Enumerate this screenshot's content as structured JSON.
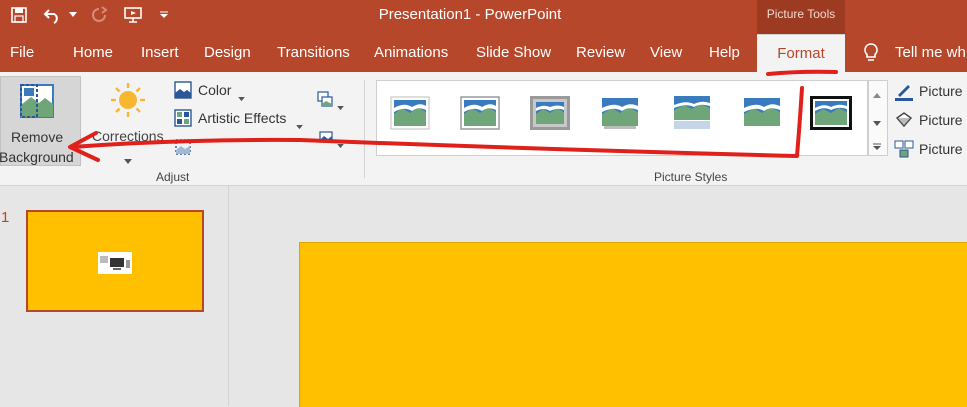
{
  "window": {
    "title": "Presentation1  -  PowerPoint",
    "context_tab_label": "Picture Tools"
  },
  "tabs": [
    {
      "label": "File"
    },
    {
      "label": "Home"
    },
    {
      "label": "Insert"
    },
    {
      "label": "Design"
    },
    {
      "label": "Transitions"
    },
    {
      "label": "Animations"
    },
    {
      "label": "Slide Show"
    },
    {
      "label": "Review"
    },
    {
      "label": "View"
    },
    {
      "label": "Help"
    },
    {
      "label": "Format"
    }
  ],
  "tell_me": "Tell me wh",
  "adjust": {
    "remove_bg_line1": "Remove",
    "remove_bg_line2": "Background",
    "corrections": "Corrections",
    "color": "Color",
    "artistic_effects": "Artistic Effects",
    "group_label": "Adjust"
  },
  "picture_styles": {
    "group_label": "Picture Styles",
    "right_items": [
      "Picture",
      "Picture",
      "Picture"
    ]
  },
  "slides": [
    {
      "number": "1"
    }
  ],
  "colors": {
    "accent": "#b7472a",
    "slide_bg": "#ffc000",
    "annotation": "#e0201b"
  }
}
